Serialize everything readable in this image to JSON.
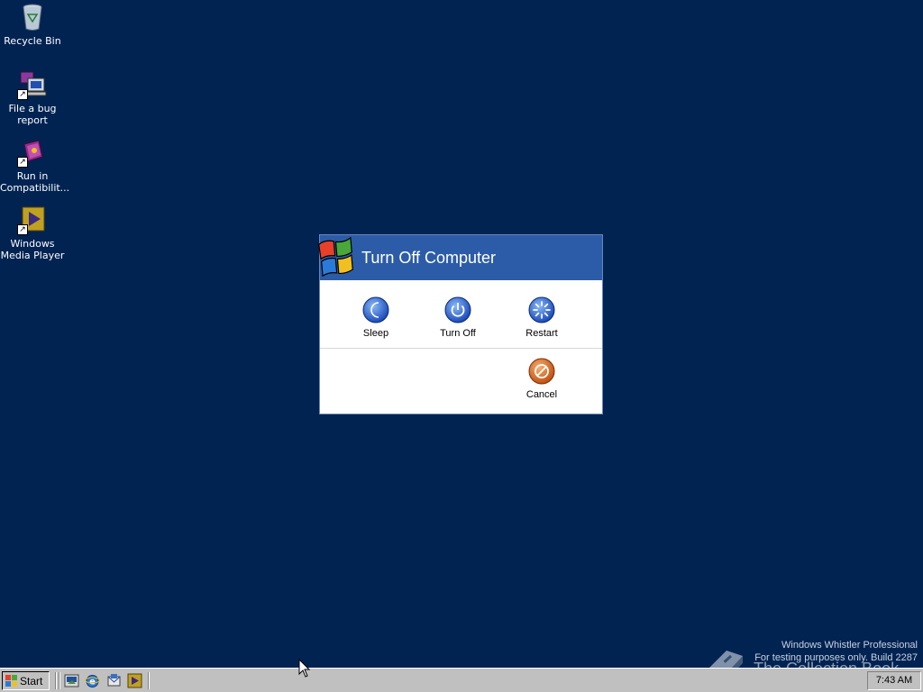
{
  "desktop": {
    "background": "#002352",
    "icons": [
      {
        "label": "Recycle Bin",
        "icon": "recycle-bin-icon"
      },
      {
        "label": "File a bug report",
        "icon": "bug-report-icon"
      },
      {
        "label": "Run in Compatibilit...",
        "icon": "compatibility-icon"
      },
      {
        "label": "Windows Media Player",
        "icon": "media-player-icon"
      }
    ]
  },
  "dialog": {
    "title": "Turn Off Computer",
    "header_color": "#2c5ca8",
    "buttons": {
      "sleep": "Sleep",
      "turn_off": "Turn Off",
      "restart": "Restart",
      "cancel": "Cancel"
    }
  },
  "watermark": {
    "line1": "Windows Whistler Professional",
    "line2": "For testing purposes only. Build 2287",
    "overlay": "The Collection Book"
  },
  "taskbar": {
    "start_label": "Start",
    "quick_launch": [
      "show-desktop-icon",
      "internet-explorer-icon",
      "outlook-express-icon",
      "media-player-icon"
    ],
    "clock": "7:43 AM"
  }
}
